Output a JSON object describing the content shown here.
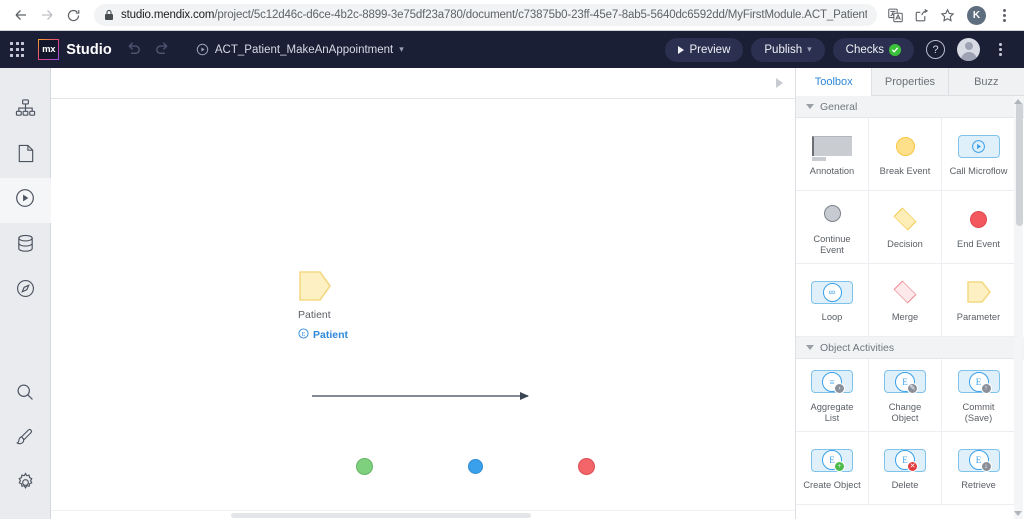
{
  "browser": {
    "back_icon": "back-arrow-icon",
    "forward_icon": "forward-arrow-icon",
    "reload_icon": "reload-icon",
    "lock_icon": "lock-icon",
    "url": "studio.mendix.com/project/5c12d46c-d6ce-4b2c-8899-3e75df23a780/document/c73875b0-23ff-45e7-8ab5-5640dc6592dd/MyFirstModule.ACT_Patient_…",
    "url_domain": "studio.mendix.com",
    "url_path": "/project/5c12d46c-d6ce-4b2c-8899-3e75df23a780/document/c73875b0-23ff-45e7-8ab5-5640dc6592dd/MyFirstModule.ACT_Patient_…",
    "translate_icon": "translate-icon",
    "share_icon": "share-icon",
    "bookmark_icon": "star-icon",
    "profile_initial": "K",
    "menu_icon": "kebab-menu-icon"
  },
  "appbar": {
    "apps_icon": "app-grid-icon",
    "logo_text": "mx",
    "product_name": "Studio",
    "undo_icon": "undo-icon",
    "redo_icon": "redo-icon",
    "document_icon": "microflow-icon",
    "document_name": "ACT_Patient_MakeAnAppointment",
    "document_chevron": "chevron-down-icon",
    "preview_label": "Preview",
    "preview_icon": "play-icon",
    "publish_label": "Publish",
    "publish_chevron": "chevron-down-icon",
    "checks_label": "Checks",
    "checks_status_icon": "check-circle-icon",
    "help_label": "?",
    "avatar_icon": "user-avatar-icon",
    "overflow_icon": "kebab-menu-icon",
    "checks_color": "#3cc13b",
    "bar_color": "#1b1f36"
  },
  "rail": {
    "items": [
      {
        "name": "sidebar-item-domain-model",
        "icon": "hierarchy-icon",
        "active": false
      },
      {
        "name": "sidebar-item-pages",
        "icon": "page-icon",
        "active": false
      },
      {
        "name": "sidebar-item-microflows",
        "icon": "microflow-play-icon",
        "active": true
      },
      {
        "name": "sidebar-item-data",
        "icon": "database-icon",
        "active": false
      },
      {
        "name": "sidebar-item-navigation",
        "icon": "compass-icon",
        "active": false
      }
    ],
    "bottom_items": [
      {
        "name": "sidebar-item-search",
        "icon": "search-icon"
      },
      {
        "name": "sidebar-item-theme",
        "icon": "brush-icon"
      },
      {
        "name": "sidebar-item-settings",
        "icon": "gear-icon"
      }
    ]
  },
  "canvas": {
    "collapse_icon": "collapse-right-icon",
    "parameter": {
      "shape": "parameter-shape",
      "label": "Patient",
      "entity_icon": "entity-icon",
      "entity_name": "Patient",
      "entity_color": "#2f87d8",
      "fill": "#fdeeb8"
    },
    "flow": {
      "start_name": "start-event",
      "start_color": "#7ed07e",
      "mid_name": "flow-midpoint",
      "mid_color": "#3aa0ec",
      "end_name": "end-event",
      "end_color": "#f4656a",
      "connector_name": "sequence-flow-arrow"
    }
  },
  "toolbox": {
    "tabs": [
      {
        "label": "Toolbox",
        "active": true
      },
      {
        "label": "Properties",
        "active": false
      },
      {
        "label": "Buzz",
        "active": false
      }
    ],
    "sections": [
      {
        "title": "General",
        "items": [
          {
            "label": "Annotation",
            "icon": "annotation-icon"
          },
          {
            "label": "Break Event",
            "icon": "break-event-icon"
          },
          {
            "label": "Call Microflow",
            "icon": "call-microflow-icon"
          },
          {
            "label": "Continue\nEvent",
            "icon": "continue-event-icon"
          },
          {
            "label": "Decision",
            "icon": "decision-icon"
          },
          {
            "label": "End Event",
            "icon": "end-event-icon"
          },
          {
            "label": "Loop",
            "icon": "loop-icon"
          },
          {
            "label": "Merge",
            "icon": "merge-icon"
          },
          {
            "label": "Parameter",
            "icon": "parameter-icon"
          }
        ]
      },
      {
        "title": "Object Activities",
        "items": [
          {
            "label": "Aggregate\nList",
            "icon": "aggregate-list-icon"
          },
          {
            "label": "Change\nObject",
            "icon": "change-object-icon"
          },
          {
            "label": "Commit\n(Save)",
            "icon": "commit-save-icon"
          },
          {
            "label": "Create Object",
            "icon": "create-object-icon"
          },
          {
            "label": "Delete",
            "icon": "delete-object-icon"
          },
          {
            "label": "Retrieve",
            "icon": "retrieve-object-icon"
          }
        ]
      }
    ]
  }
}
